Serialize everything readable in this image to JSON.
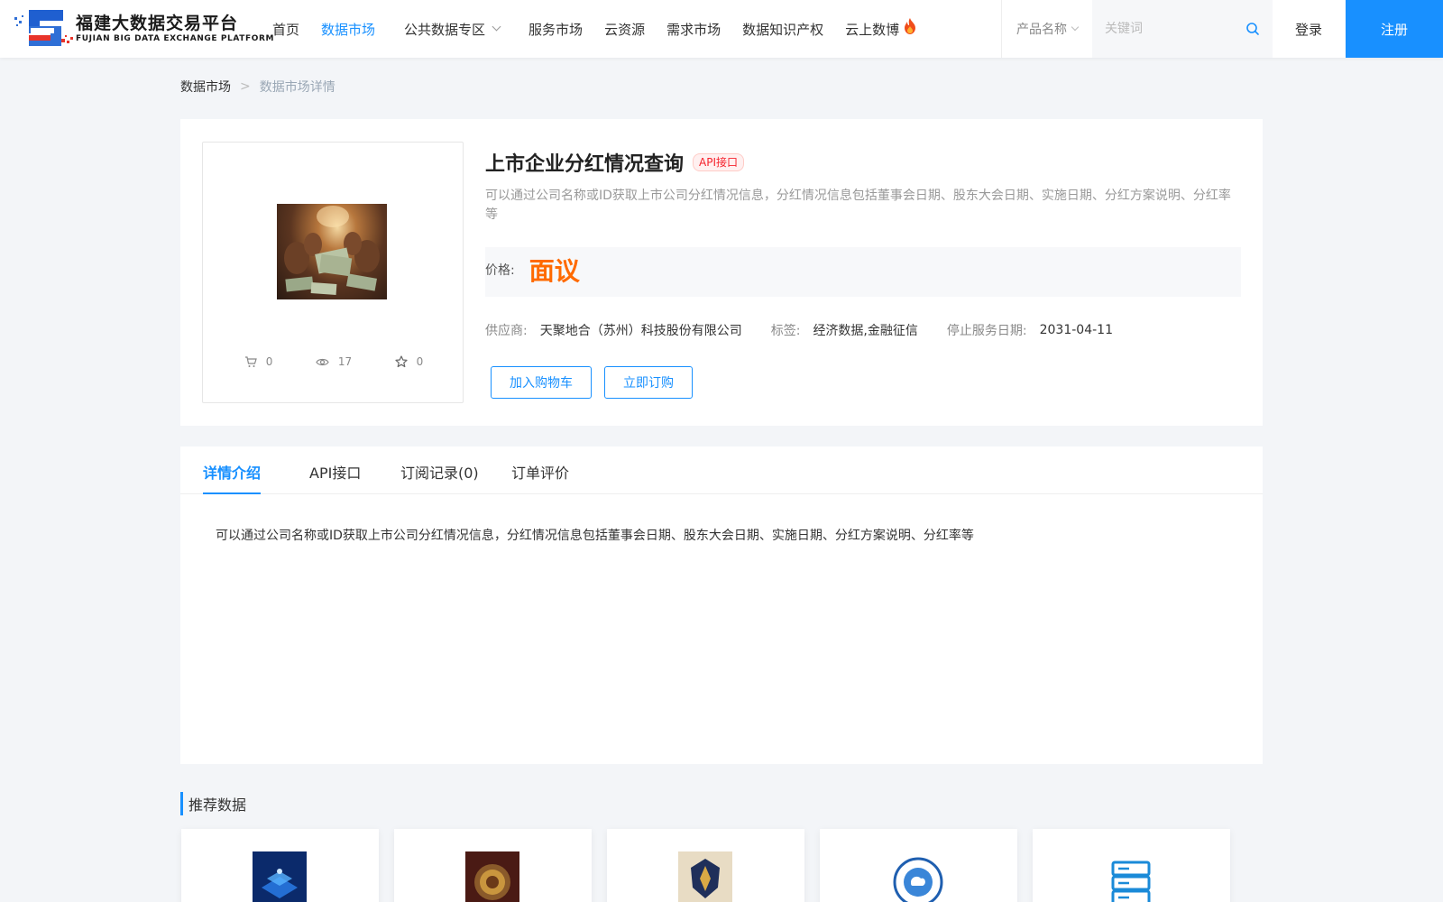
{
  "header": {
    "logo_cn": "福建大数据交易平台",
    "logo_en": "FUJIAN BIG DATA EXCHANGE  PLATFORM",
    "nav": [
      {
        "label": "首页"
      },
      {
        "label": "数据市场"
      },
      {
        "label": "公共数据专区"
      },
      {
        "label": "服务市场"
      },
      {
        "label": "云资源"
      },
      {
        "label": "需求市场"
      },
      {
        "label": "数据知识产权"
      },
      {
        "label": "云上数博"
      }
    ],
    "search_type": "产品名称",
    "search_placeholder": "关键词",
    "login": "登录",
    "register": "注册"
  },
  "breadcrumb": {
    "home": "数据市场",
    "sep": ">",
    "current": "数据市场详情"
  },
  "product": {
    "title": "上市企业分红情况查询",
    "badge": "API接口",
    "desc": "可以通过公司名称或ID获取上市公司分红情况信息，分红情况信息包括董事会日期、股东大会日期、实施日期、分红方案说明、分红率等",
    "price_label": "价格:",
    "price": "面议",
    "supplier_label": "供应商:",
    "supplier": "天聚地合（苏州）科技股份有限公司",
    "tags_label": "标签:",
    "tags": "经济数据,金融征信",
    "stop_label": "停止服务日期:",
    "stop_date": "2031-04-11",
    "stats": {
      "cart": "0",
      "views": "17",
      "favorites": "0"
    },
    "add_cart": "加入购物车",
    "subscribe": "立即订购"
  },
  "tabs": [
    {
      "label": "详情介绍"
    },
    {
      "label": "API接口"
    },
    {
      "label": "订阅记录(0)"
    },
    {
      "label": "订单评价"
    }
  ],
  "detail_text": "可以通过公司名称或ID获取上市公司分红情况信息，分红情况信息包括董事会日期、股东大会日期、实施日期、分红方案说明、分红率等",
  "recommend": {
    "title": "推荐数据"
  },
  "colors": {
    "accent": "#1890ff",
    "price": "#ff6a00",
    "badge": "#f5222d"
  }
}
